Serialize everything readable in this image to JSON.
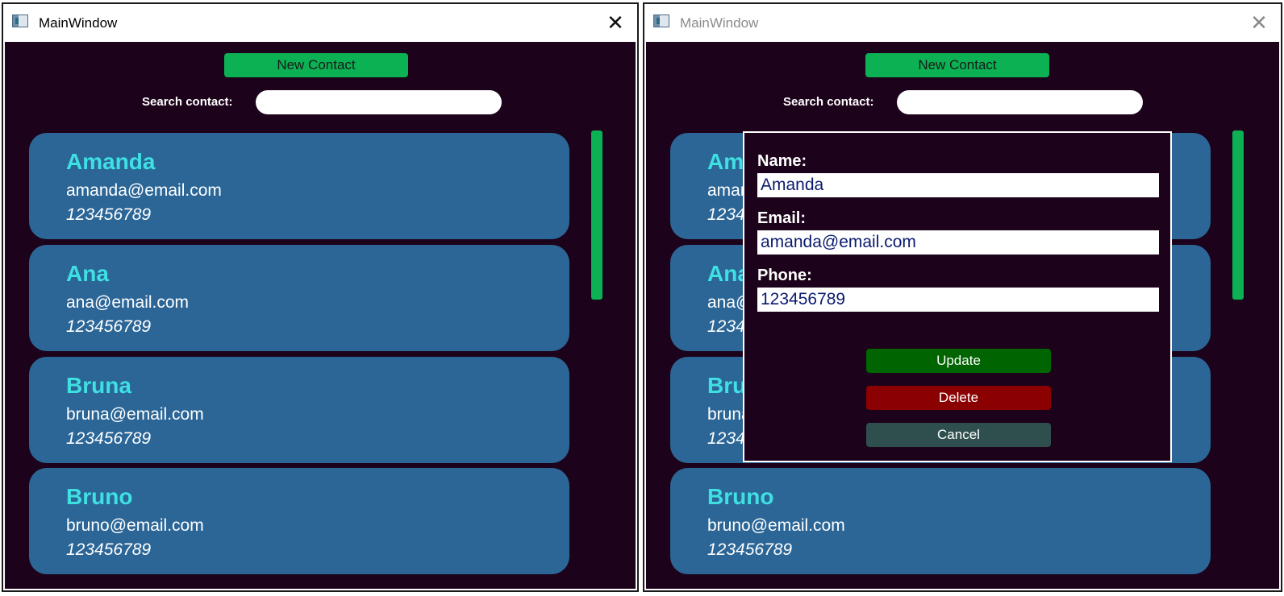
{
  "left_window": {
    "title": "MainWindow",
    "new_contact_label": "New Contact",
    "search_label": "Search contact:",
    "search_value": "",
    "contacts": [
      {
        "name": "Amanda",
        "email": "amanda@email.com",
        "phone": "123456789"
      },
      {
        "name": "Ana",
        "email": "ana@email.com",
        "phone": "123456789"
      },
      {
        "name": "Bruna",
        "email": "bruna@email.com",
        "phone": "123456789"
      },
      {
        "name": "Bruno",
        "email": "bruno@email.com",
        "phone": "123456789"
      }
    ]
  },
  "right_window": {
    "title": "MainWindow",
    "new_contact_label": "New Contact",
    "search_label": "Search contact:",
    "search_value": "",
    "contacts": [
      {
        "name": "Amanda",
        "email": "amanda@email.com",
        "phone": "123456789"
      },
      {
        "name": "Ana",
        "email": "ana@email.com",
        "phone": "123456789"
      },
      {
        "name": "Bruna",
        "email": "bruna@email.com",
        "phone": "123456789"
      },
      {
        "name": "Bruno",
        "email": "bruno@email.com",
        "phone": "123456789"
      }
    ],
    "edit_dialog": {
      "name_label": "Name:",
      "name_value": "Amanda",
      "email_label": "Email:",
      "email_value": "amanda@email.com",
      "phone_label": "Phone:",
      "phone_value": "123456789",
      "update_label": "Update",
      "delete_label": "Delete",
      "cancel_label": "Cancel"
    }
  },
  "colors": {
    "background": "#1c021a",
    "card": "#2b6697",
    "contact_name": "#3fe0e2",
    "new_contact_button": "#0bb152",
    "scrollbar": "#0bb152",
    "update_button": "#006400",
    "delete_button": "#8b0000",
    "cancel_button": "#2f4f4f"
  },
  "icons": {
    "app": "app-window-icon",
    "close": "close-icon"
  }
}
